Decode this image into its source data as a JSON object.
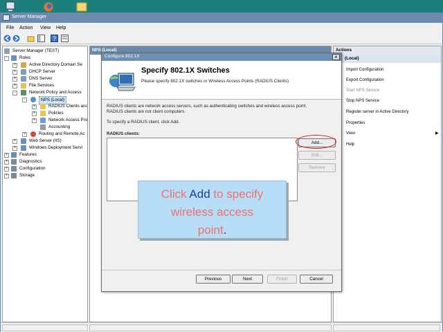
{
  "window": {
    "title": "Server Manager",
    "menu": [
      "File",
      "Action",
      "View",
      "Help"
    ]
  },
  "tree": {
    "root": "Server Manager (TEST)",
    "roles": "Roles",
    "ad": "Active Directory Domain Se",
    "dhcp": "DHCP Server",
    "dns": "DNS Server",
    "file": "File Services",
    "npas": "Network Policy and Access",
    "nps": "NPS (Local)",
    "radius": "RADIUS Clients and",
    "policies": "Policies",
    "nap": "Network Access Pro",
    "accounting": "Accounting",
    "rras": "Routing and Remote Ac",
    "iis": "Web Server (IIS)",
    "wds": "Windows Deployment Servi",
    "features": "Features",
    "diagnostics": "Diagnostics",
    "configuration": "Configuration",
    "storage": "Storage"
  },
  "middle": {
    "header": "NPS (Local)"
  },
  "actions": {
    "header": "Actions",
    "sub": "(Local)",
    "items": [
      {
        "label": "Import Configuration"
      },
      {
        "label": "Export Configuration"
      },
      {
        "label": "Start NPS Service"
      },
      {
        "label": "Stop NPS Service"
      },
      {
        "label": "Register server in Active Directory"
      },
      {
        "label": "Properties"
      },
      {
        "label": "View"
      },
      {
        "label": "Help"
      }
    ]
  },
  "dialog": {
    "title": "Configure 802.1X",
    "close": "×",
    "heading": "Specify 802.1X Switches",
    "subheading": "Please specify 802.1X switches or Wireless Access Points (RADIUS Clients)",
    "desc1": "RADIUS clients are network access servers, such as authenticating switches and wireless access point.",
    "desc2": "RADIUS clients are not client computers.",
    "instruction": "To specify a RADIUS client, click Add.",
    "list_label": "RADIUS clients:",
    "add": "Add...",
    "edit": "Edit...",
    "remove": "Remove",
    "previous": "Previous",
    "next": "Next",
    "finish": "Finish",
    "cancel": "Cancel"
  },
  "callout": {
    "t1": "Click ",
    "t2": "Add",
    "t3": " to specify",
    "t4": "wireless access",
    "t5": "point",
    "t6": "."
  },
  "colors": {
    "accent": "#6b8cae",
    "callout_bg": "#b7ddf7",
    "callout_text": "#f07070",
    "highlight_ring": "#d02020"
  }
}
